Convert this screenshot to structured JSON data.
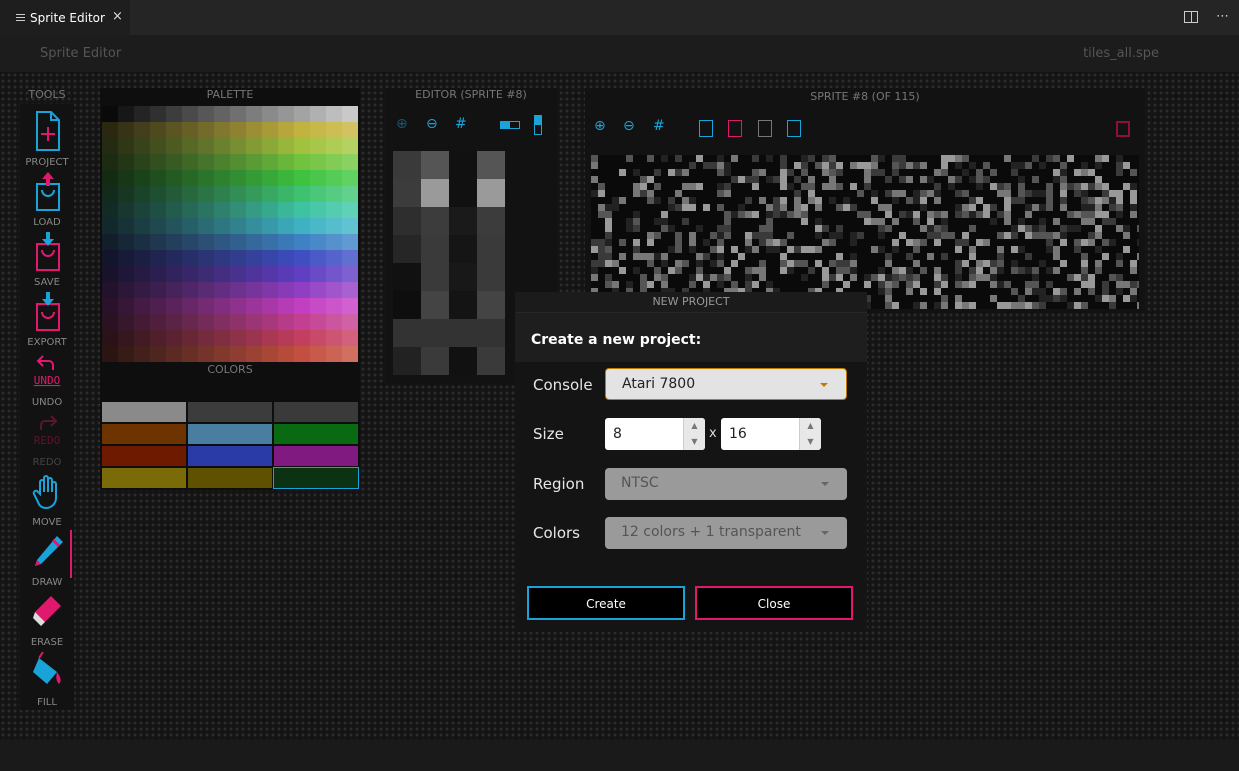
{
  "tab": {
    "title": "Sprite Editor",
    "close": "×"
  },
  "header": {
    "title": "Sprite Editor",
    "file": "tiles_all.spe"
  },
  "tools": {
    "label": "TOOLS",
    "items": [
      {
        "label": "PROJECT",
        "icon": "new-project-icon",
        "color": "#e0196f"
      },
      {
        "label": "LOAD",
        "icon": "load-icon",
        "color": "#e0196f"
      },
      {
        "label": "SAVE",
        "icon": "save-icon",
        "color": "#e0196f"
      },
      {
        "label": "EXPORT",
        "icon": "export-icon",
        "color": "#e0196f"
      },
      {
        "label": "UNDO",
        "icon": "undo-icon",
        "color": "#e0196f"
      },
      {
        "label": "REDO",
        "icon": "redo-icon",
        "color": "#5a1530"
      },
      {
        "label": "MOVE",
        "icon": "hand-icon",
        "color": "#1aa3d9"
      },
      {
        "label": "DRAW",
        "icon": "pencil-icon",
        "color": "#e0196f"
      },
      {
        "label": "ERASE",
        "icon": "eraser-icon",
        "color": "#e0196f"
      },
      {
        "label": "FILL",
        "icon": "fill-bucket-icon",
        "color": "#1aa3d9"
      }
    ],
    "undo_word": "UNDO",
    "redo_word": "REDO"
  },
  "palette": {
    "label": "PALETTE",
    "colors_label": "COLORS",
    "swatches": [
      "#8a8a8a",
      "#3c3c3c",
      "#3a3a3a",
      "#6e3400",
      "#4a7ea0",
      "#0a6a14",
      "#6e1a00",
      "#2a3aa6",
      "#801a80",
      "#7a6a08",
      "#5e5200",
      "#0c3214"
    ]
  },
  "editor": {
    "label": "EDITOR (SPRITE #8)"
  },
  "sprite": {
    "label": "SPRITE #8 (OF 115)"
  },
  "modal": {
    "title": "NEW PROJECT",
    "subtitle": "Create a new project:",
    "console_label": "Console",
    "console_value": "Atari 7800",
    "size_label": "Size",
    "width": "8",
    "x": "x",
    "height": "16",
    "region_label": "Region",
    "region_value": "NTSC",
    "colors_label": "Colors",
    "colors_value": "12 colors + 1 transparent",
    "create": "Create",
    "close": "Close"
  },
  "accent": {
    "cyan": "#1aa3d9",
    "magenta": "#e0196f"
  }
}
